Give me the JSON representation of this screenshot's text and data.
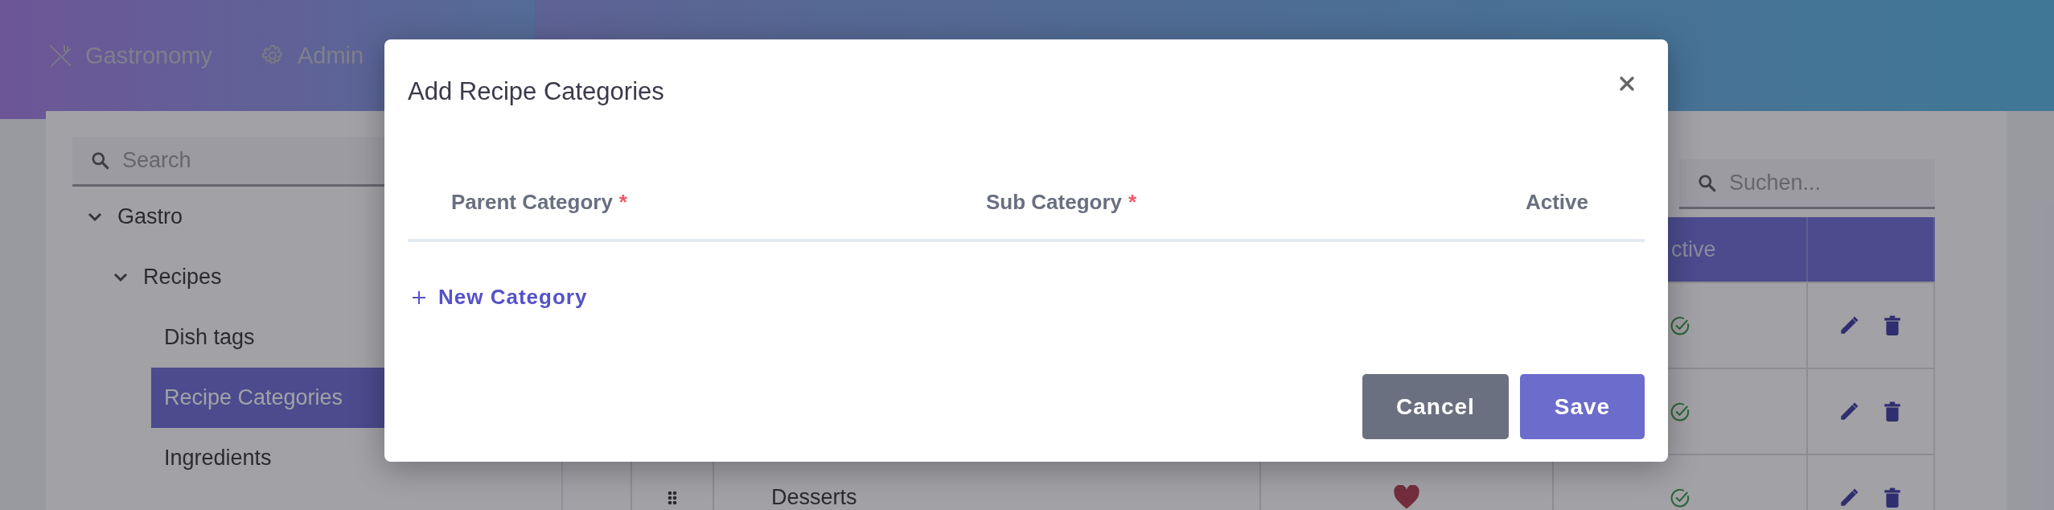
{
  "nav": [
    {
      "label": "Gastronomy",
      "kind": "utensils"
    },
    {
      "label": "Admin",
      "kind": "gear"
    }
  ],
  "sidebar": {
    "search": {
      "placeholder": "Search"
    },
    "tree": [
      {
        "label": "Gastro",
        "expanded": true,
        "selected": false,
        "children": [
          {
            "label": "Recipes",
            "expanded": true,
            "selected": false,
            "children": [
              {
                "label": "Dish tags",
                "selected": false
              },
              {
                "label": "Recipe Categories",
                "selected": true
              },
              {
                "label": "Ingredients",
                "selected": false
              }
            ]
          }
        ]
      }
    ]
  },
  "main": {
    "search": {
      "placeholder": "Suchen..."
    },
    "table": {
      "active_header": "ctive",
      "rows": [
        {
          "active": true
        },
        {
          "active": true
        },
        {
          "name": "Desserts",
          "favorite": true,
          "active": true
        }
      ]
    }
  },
  "modal": {
    "title": "Add Recipe Categories",
    "columns": [
      {
        "label": "Parent Category",
        "required_mark": "*"
      },
      {
        "label": "Sub Category",
        "required_mark": "*"
      },
      {
        "label": "Active"
      }
    ],
    "add_link": "New Category",
    "buttons": [
      {
        "label": "Cancel",
        "kind": "secondary"
      },
      {
        "label": "Save",
        "kind": "primary"
      }
    ]
  }
}
